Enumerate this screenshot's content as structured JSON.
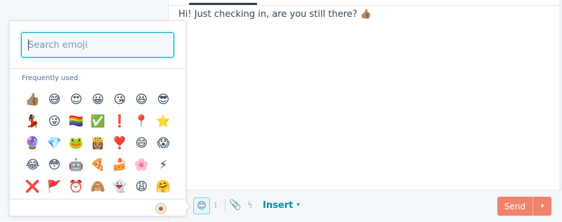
{
  "conversation": {
    "message_text": "Hi! Just checking in, are you still there?",
    "message_emoji": "👍🏽"
  },
  "emoji_picker": {
    "search_placeholder": "Search emoji",
    "section_title": "Frequently used",
    "emojis": [
      {
        "char": "👍🏽",
        "name": "thumbs-up-medium-skin"
      },
      {
        "char": "😅",
        "name": "grinning-sweat"
      },
      {
        "char": "😍",
        "name": "heart-eyes"
      },
      {
        "char": "😀",
        "name": "grinning-face"
      },
      {
        "char": "😘",
        "name": "face-blowing-kiss"
      },
      {
        "char": "😆",
        "name": "grinning-squinting"
      },
      {
        "char": "😎",
        "name": "smiling-sunglasses"
      },
      {
        "char": "💃🏿",
        "name": "woman-dancing"
      },
      {
        "char": "😜",
        "name": "winking-tongue"
      },
      {
        "char": "🏳️‍🌈",
        "name": "rainbow-flag"
      },
      {
        "char": "✅",
        "name": "check-mark-button"
      },
      {
        "char": "❗",
        "name": "exclamation-mark"
      },
      {
        "char": "📍",
        "name": "round-pushpin"
      },
      {
        "char": "⭐",
        "name": "star"
      },
      {
        "char": "🔮",
        "name": "crystal-ball"
      },
      {
        "char": "💎",
        "name": "gem-stone"
      },
      {
        "char": "🐸",
        "name": "frog"
      },
      {
        "char": "👸🏽",
        "name": "princess"
      },
      {
        "char": "❣️",
        "name": "heart-exclamation"
      },
      {
        "char": "😄",
        "name": "grinning-smiling-eyes"
      },
      {
        "char": "😱",
        "name": "screaming-in-fear"
      },
      {
        "char": "😂",
        "name": "tears-of-joy"
      },
      {
        "char": "😳",
        "name": "flushed-face"
      },
      {
        "char": "🤖",
        "name": "robot"
      },
      {
        "char": "🍕",
        "name": "pizza"
      },
      {
        "char": "🍰",
        "name": "shortcake"
      },
      {
        "char": "🌸",
        "name": "cherry-blossom"
      },
      {
        "char": "⚡",
        "name": "high-voltage"
      },
      {
        "char": "❌",
        "name": "cross-mark"
      },
      {
        "char": "🚩",
        "name": "triangular-flag"
      },
      {
        "char": "⏰",
        "name": "alarm-clock"
      },
      {
        "char": "🙈",
        "name": "see-no-evil-monkey"
      },
      {
        "char": "👻",
        "name": "ghost"
      },
      {
        "char": "😩",
        "name": "weary-face"
      },
      {
        "char": "🤗",
        "name": "hugging-face"
      }
    ],
    "skin_tone_color": "#a36a43"
  },
  "toolbar": {
    "emoji_icon": "😊",
    "snippet_icon": "⁝",
    "attach_icon": "📎",
    "bolt_icon": "ϟ",
    "insert_label": "Insert",
    "insert_caret": "▾",
    "send_label": "Send",
    "send_caret": "▾"
  },
  "colors": {
    "accent": "#00a4bd",
    "send_button": "#f2826b",
    "link": "#0091ae"
  }
}
